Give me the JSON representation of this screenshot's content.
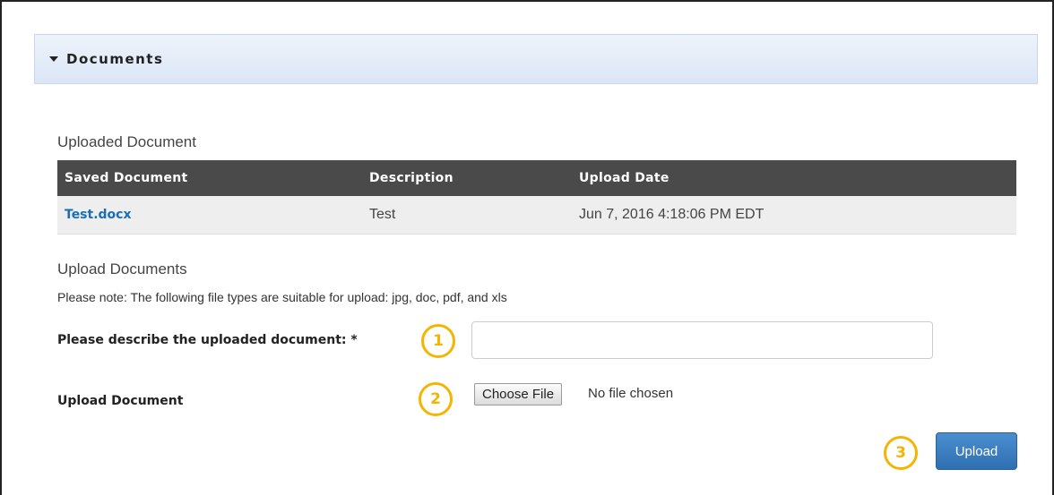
{
  "panel": {
    "title": "Documents"
  },
  "uploaded": {
    "heading": "Uploaded Document",
    "columns": [
      "Saved Document",
      "Description",
      "Upload Date"
    ],
    "rows": [
      {
        "file": "Test.docx",
        "description": "Test",
        "date": "Jun 7, 2016 4:18:06 PM EDT"
      }
    ]
  },
  "upload_form": {
    "heading": "Upload Documents",
    "note": "Please note: The following file types are suitable for upload: jpg, doc, pdf, and xls",
    "describe_label": "Please describe the uploaded document: *",
    "describe_value": "",
    "upload_label": "Upload Document",
    "choose_file_label": "Choose File",
    "no_file_text": "No file chosen",
    "submit_label": "Upload"
  },
  "callouts": [
    "1",
    "2",
    "3"
  ],
  "colors": {
    "accent": "#f5b400",
    "link": "#1a6fb3",
    "primary_button": "#3a7fc1",
    "table_header": "#4a4a4a"
  }
}
